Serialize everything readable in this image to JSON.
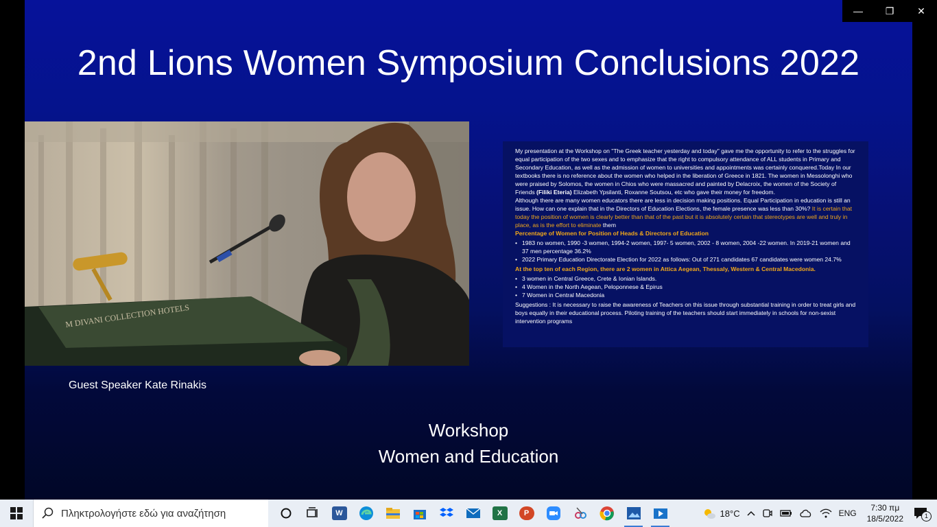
{
  "slide": {
    "title": "2nd Lions Women Symposium Conclusions 2022",
    "caption": "Guest Speaker Kate Rinakis",
    "workshop_line1": "Workshop",
    "workshop_line2": "Women and Education",
    "podium_sign": "M DIVANI COLLECTION HOTELS"
  },
  "text_panel": {
    "para1": "My presentation at the Workshop on \"The Greek teacher yesterday and today\" gave me the opportunity to refer to the struggles for equal participation of the two sexes and to emphasize that the right to compulsory attendance of ALL students in Primary and Secondary Education, as well as the admission of women to universities and appointments was certainly conquered.Today In our textbooks there is no reference about the women who helped in the liberation of Greece in 1821. The women in Messolonghi who were praised by Solomos, the women in Chios who were massacred and painted by Delacroix, the women of the Society of Friends",
    "para1_bold": "(Filiki Eteria)",
    "para1_end": "Elizabeth Ypsilanti, Roxanne Soutsou, etc who gave their money for freedom.",
    "para2": "Although there are many women educators there are less in decision making positions. Equal Participation in education is still an issue. How can one explain that in the Directors of Education Elections, the female presence was less than 30%?",
    "para2_orange": "It is certain that today the position of women is clearly better than that of the past but it is absolutely certain that stereotypes are well and truly in place, as is the effort to eliminate",
    "para2_end": "them",
    "heading1": "Percentage of Women for Position of Heads & Directors of Education",
    "list1": [
      "1983 no women, 1990 -3 women, 1994-2 women, 1997- 5 women, 2002 - 8 women, 2004 -22 women. In 2019-21 women and 37 men percentage 36.2%",
      "2022 Primary Education Directorate Election for 2022 as follows: Out of 271 candidates 67 candidates were women 24.7%"
    ],
    "heading2": "At the top ten of each Region, there are 2 women in Attica Aegean, Thessaly, Western & Central Macedonia.",
    "list2": [
      "3 women in Central Greece, Crete & Ionian Islands.",
      "4 Women in the North Aegean, Peloponnese & Epirus",
      "7 Women in Central Macedonia"
    ],
    "suggestions": "Suggestions : It is necessary to raise the awareness of Teachers on this issue through substantial training in order to treat girls and boys equally in their educational process. Piloting  training of the teachers should start immediately in schools for non-sexist intervention programs"
  },
  "window_controls": {
    "minimize": "—",
    "restore": "❐",
    "close": "✕"
  },
  "taskbar": {
    "search_placeholder": "Πληκτρολογήστε εδώ για αναζήτηση",
    "apps": [
      {
        "name": "cortana-icon"
      },
      {
        "name": "task-view-icon"
      },
      {
        "name": "word-icon",
        "letter": "W",
        "color": "#2b579a"
      },
      {
        "name": "edge-icon",
        "color": "#0c8ed9"
      },
      {
        "name": "file-explorer-icon",
        "color": "#f2c037"
      },
      {
        "name": "store-icon",
        "color": "#1b6fc7"
      },
      {
        "name": "dropbox-icon",
        "color": "#0061fe"
      },
      {
        "name": "mail-icon",
        "color": "#0f6cbd"
      },
      {
        "name": "excel-icon",
        "letter": "X",
        "color": "#217346"
      },
      {
        "name": "powerpoint-icon",
        "letter": "P",
        "color": "#d24726"
      },
      {
        "name": "zoom-icon",
        "color": "#2d8cff"
      },
      {
        "name": "snip-icon",
        "color": "#c8385f"
      },
      {
        "name": "chrome-icon",
        "color": "#db4437"
      },
      {
        "name": "photos-icon",
        "color": "#1e5aa8"
      },
      {
        "name": "movies-icon",
        "color": "#1a73c9"
      }
    ],
    "temperature": "18°C",
    "language": "ENG",
    "time": "7:30 πμ",
    "date": "18/5/2022",
    "notification_count": "1"
  }
}
